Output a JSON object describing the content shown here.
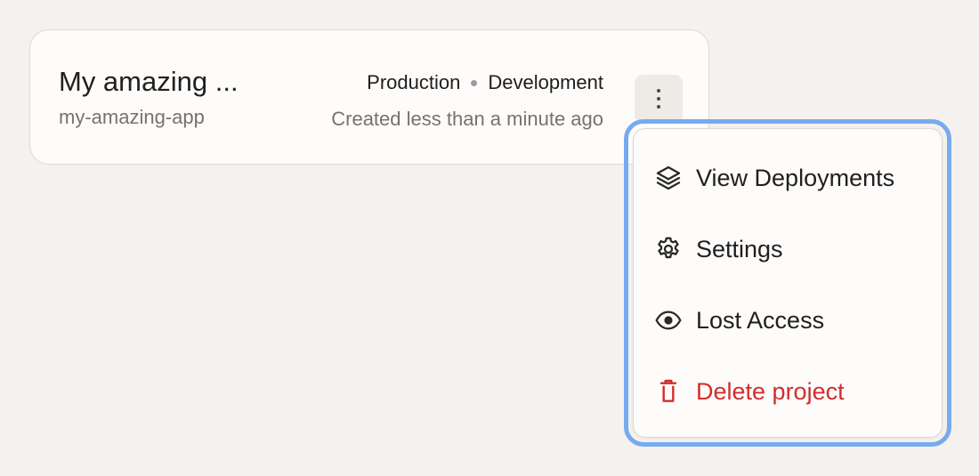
{
  "project": {
    "name": "My amazing ...",
    "slug": "my-amazing-app",
    "environments": [
      "Production",
      "Development"
    ],
    "created": "Created less than a minute ago"
  },
  "actions": {
    "menu_button_icon": "kebab-vertical-icon"
  },
  "menu": {
    "items": [
      {
        "label": "View Deployments",
        "icon": "layers-icon"
      },
      {
        "label": "Settings",
        "icon": "gear-icon"
      },
      {
        "label": "Lost Access",
        "icon": "eye-icon"
      },
      {
        "label": "Delete project",
        "icon": "trash-icon",
        "color": "#d22d2d"
      }
    ]
  },
  "colors": {
    "background": "#f4f1ee",
    "card": "#fdfcfb",
    "focus_ring": "#78aaee",
    "danger": "#d22d2d",
    "muted_text": "#77726d"
  }
}
